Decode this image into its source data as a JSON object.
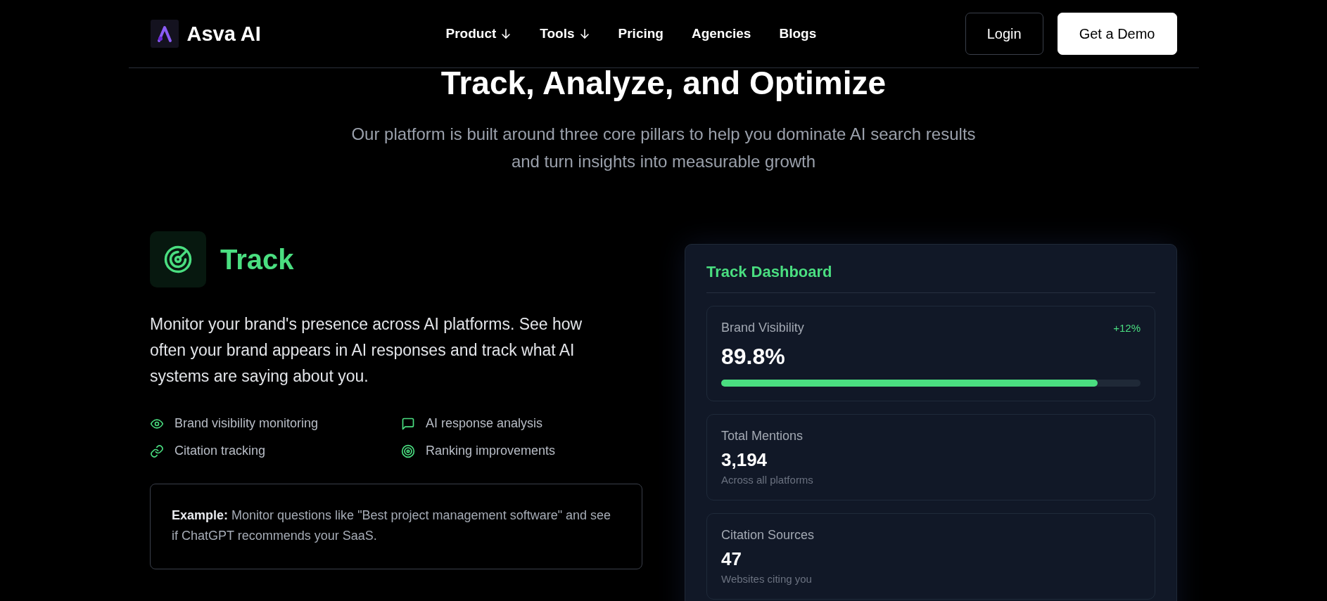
{
  "header": {
    "logo_text": "Asva AI",
    "nav": [
      {
        "label": "Product",
        "dropdown": true
      },
      {
        "label": "Tools",
        "dropdown": true
      },
      {
        "label": "Pricing",
        "dropdown": false
      },
      {
        "label": "Agencies",
        "dropdown": false
      },
      {
        "label": "Blogs",
        "dropdown": false
      }
    ],
    "buttons": [
      {
        "label": "Login",
        "kind": "outline"
      },
      {
        "label": "Get a Demo",
        "kind": "solid"
      }
    ]
  },
  "hero": {
    "title": "Track, Analyze, and Optimize",
    "subtitle": "Our platform is built around three core pillars to help you dominate AI search results and turn insights into measurable growth"
  },
  "feature": {
    "title": "Track",
    "description": "Monitor your brand's presence across AI platforms. See how often your brand appears in AI responses and track what AI systems are saying about you.",
    "points": [
      {
        "label": "Brand visibility monitoring"
      },
      {
        "label": "AI response analysis"
      },
      {
        "label": "Citation tracking"
      },
      {
        "label": "Ranking improvements"
      }
    ],
    "example": "**Example:** Monitor questions like \"Best project management software\" and see if ChatGPT recommends your SaaS."
  },
  "dashboard": {
    "title": "Track Dashboard",
    "metrics": [
      {
        "kind": "progress",
        "label": "Brand Visibility",
        "value": "89.8%",
        "change": "+12%",
        "level": 0.898
      },
      {
        "kind": "plain",
        "label": "Total Mentions",
        "value": "3,194",
        "note": "Across all platforms"
      },
      {
        "kind": "plain",
        "label": "Citation Sources",
        "value": "47",
        "note": "Websites citing you"
      }
    ]
  }
}
